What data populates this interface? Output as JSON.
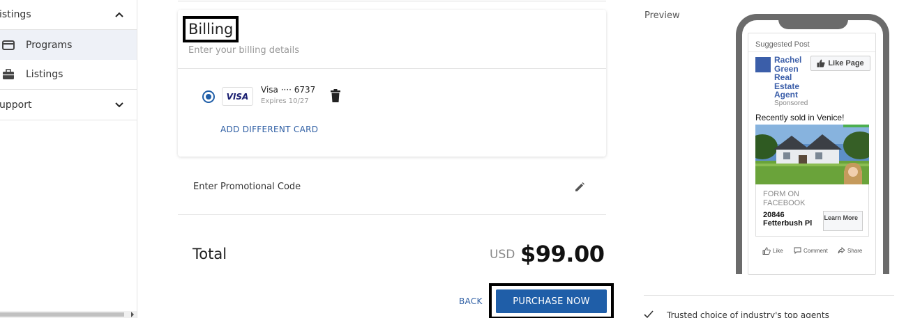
{
  "sidebar": {
    "groups": [
      {
        "label": "istings",
        "expanded": true,
        "chevron": "chevron-up-icon"
      },
      {
        "label": "upport",
        "expanded": false,
        "chevron": "chevron-down-icon"
      }
    ],
    "items": [
      {
        "label": "Programs",
        "icon": "credit-card-icon",
        "active": true
      },
      {
        "label": "Listings",
        "icon": "briefcase-icon",
        "active": false
      }
    ]
  },
  "billing": {
    "title": "Billing",
    "subtitle": "Enter your billing details",
    "card": {
      "brand": "VISA",
      "number_label": "Visa ···· 6737",
      "expires": "Expires 10/27",
      "selected": true
    },
    "add_card_label": "ADD DIFFERENT CARD"
  },
  "promo": {
    "label": "Enter Promotional Code"
  },
  "total": {
    "label": "Total",
    "currency": "USD",
    "amount": "$99.00"
  },
  "buttons": {
    "back": "BACK",
    "purchase": "PURCHASE NOW"
  },
  "preview": {
    "label": "Preview",
    "post": {
      "suggested": "Suggested Post",
      "page_name": "Rachel Green Real Estate Agent",
      "sponsored": "Sponsored",
      "like_page": "Like Page",
      "text": "Recently sold in Venice!",
      "form_label": "FORM ON FACEBOOK",
      "address": "20846 Fetterbush Pl",
      "learn_more": "Learn More",
      "actions": {
        "like": "Like",
        "comment": "Comment",
        "share": "Share"
      }
    }
  },
  "trusted": "Trusted choice of industry's top agents",
  "colors": {
    "accent": "#1f5ea8",
    "link": "#2f5fa4",
    "fb_blue": "#3b5ea9"
  }
}
